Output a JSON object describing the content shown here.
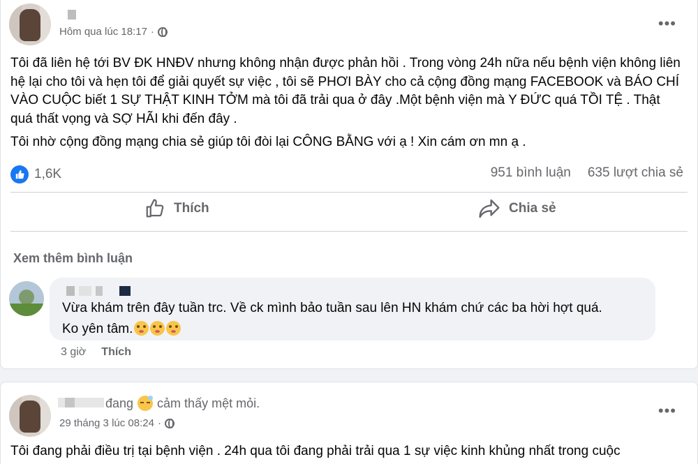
{
  "post1": {
    "timestamp": "Hôm qua lúc 18:17",
    "privacy_icon": "globe-icon",
    "more_label": "•••",
    "paragraphs": [
      "Tôi đã liên hệ tới BV ĐK HNĐV nhưng không nhận được phản hồi . Trong vòng 24h nữa nếu bệnh viện không liên hệ lại cho tôi và hẹn tôi để giải quyết sự việc , tôi sẽ PHƠI BÀY cho cả cộng đồng mạng FACEBOOK và BÁO CHÍ VÀO CUỘC  biết 1 SỰ THẬT KINH TỞM mà tôi đã trải qua ở đây .Một bệnh viện mà Y ĐỨC quá TỒI TỆ .  Thật quá thất vọng và SỢ HÃI khi đến đây .",
      "Tôi nhờ cộng đồng mạng chia sẻ giúp tôi đòi lại CÔNG BẰNG với ạ ! Xin cám ơn mn ạ ."
    ],
    "reaction_count": "1,6K",
    "comments_count": "951 bình luận",
    "shares_count": "635 lượt chia sẻ",
    "like_label": "Thích",
    "share_label": "Chia sẻ",
    "see_more_comments": "Xem thêm bình luận",
    "comment": {
      "line1": "Vừa khám trên đây tuần trc. Về ck mình bảo tuần sau lên HN khám chứ các ba hời hợt quá.",
      "line2": "Ko yên tâm.",
      "time": "3 giờ",
      "like_label": "Thích"
    }
  },
  "post2": {
    "status_prefix": "đang",
    "status_text": "cảm thấy mệt mỏi.",
    "timestamp": "29 tháng 3 lúc 08:24",
    "more_label": "•••",
    "text": "Tôi đang phải điều trị tại bệnh viện . 24h qua tôi đang phải trải qua 1 sự việc kinh khủng nhất trong cuộc"
  },
  "colors": {
    "background": "#f0f2f5",
    "card": "#ffffff",
    "secondary_text": "#65676b",
    "facebook_blue": "#1877f2"
  }
}
